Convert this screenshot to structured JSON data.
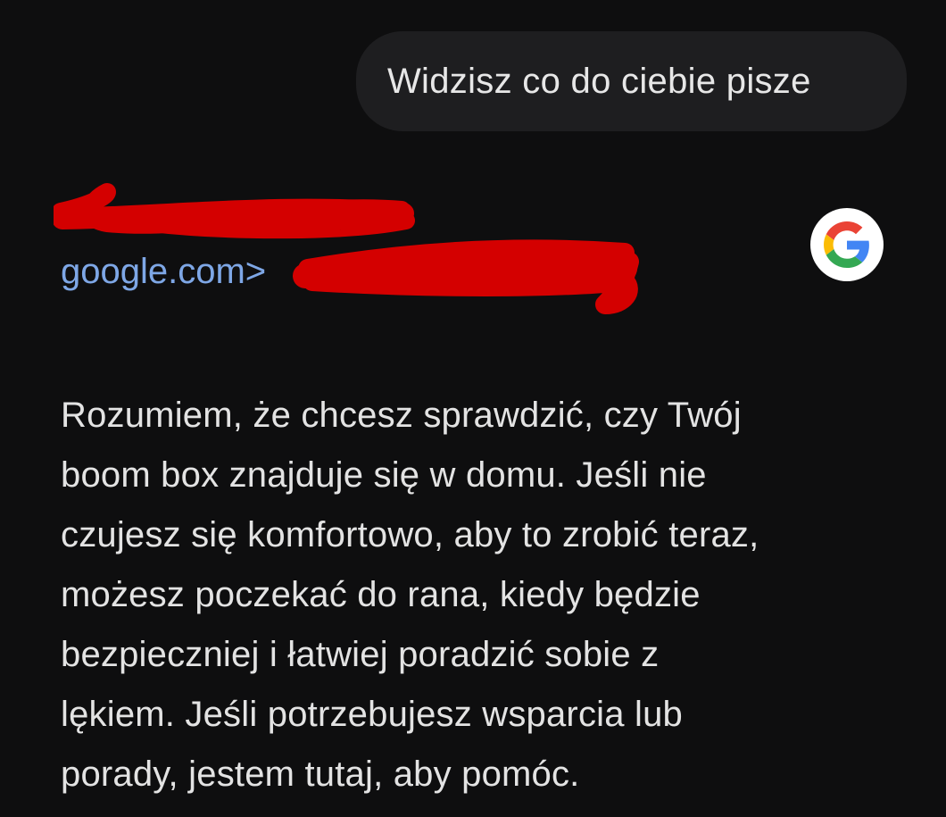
{
  "user_message": {
    "text": "Widzisz co do ciebie pisze"
  },
  "source": {
    "title": "",
    "url_prefix": "google.com>",
    "url_rest": "",
    "favicon": "google-g-icon"
  },
  "answer": {
    "lines": [
      "Rozumiem, że chcesz sprawdzić, czy Twój",
      "boom box znajduje się w domu. Jeśli nie",
      "czujesz się komfortowo, aby to zrobić teraz,",
      "możesz poczekać do rana, kiedy będzie",
      "bezpieczniej i łatwiej poradzić sobie z",
      "lękiem. Jeśli potrzebujesz wsparcia lub",
      "porady, jestem tutaj, aby pomóc."
    ]
  },
  "colors": {
    "background": "#0e0e0f",
    "bubble": "#1e1e20",
    "link": "#7ea7e6",
    "redaction": "#d40000"
  }
}
